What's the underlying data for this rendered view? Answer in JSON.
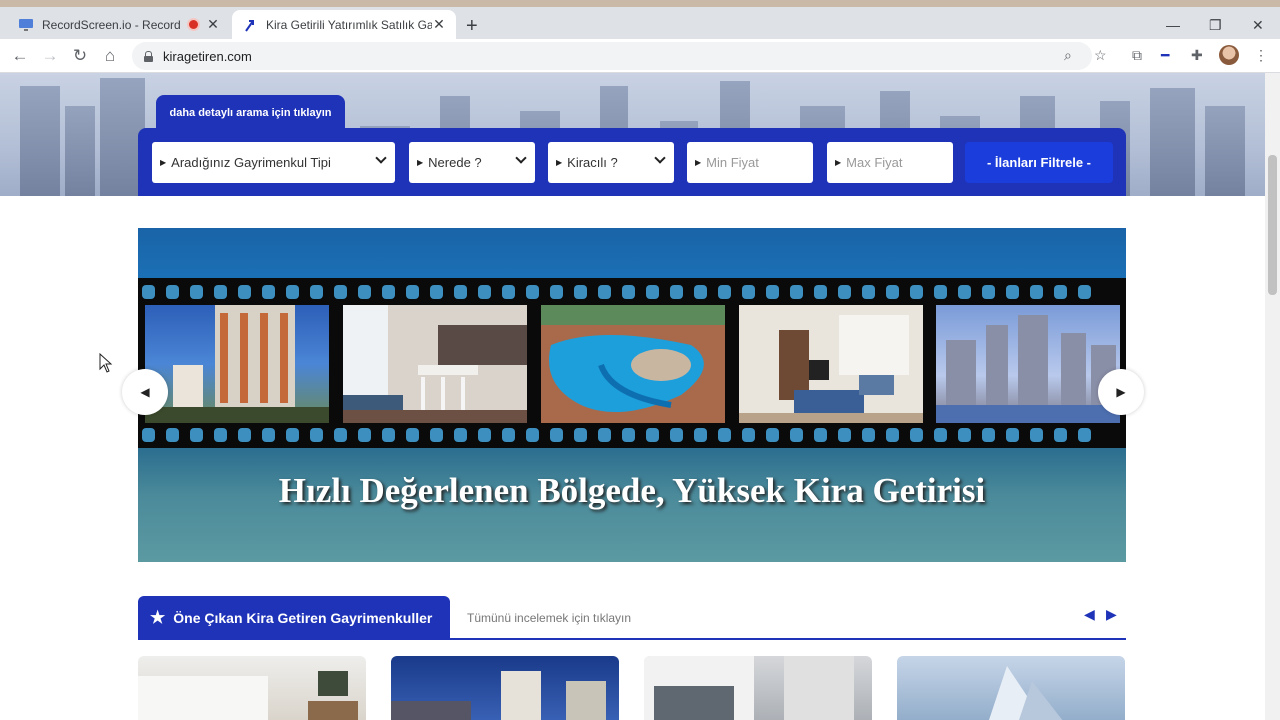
{
  "browser": {
    "tabs": [
      {
        "title": "RecordScreen.io - Record yo",
        "active": false,
        "recording": true
      },
      {
        "title": "Kira Getirili Yatırımlık Satılık Gayr",
        "active": true,
        "recording": false
      }
    ],
    "url": "kiragetiren.com"
  },
  "search": {
    "detail_tab": "daha detaylı arama için tıklayın",
    "property_type": "Aradığınız Gayrimenkul Tipi",
    "location": "Nerede ?",
    "tenant": "Kiracılı ?",
    "min_price_placeholder": "Min Fiyat",
    "max_price_placeholder": "Max Fiyat",
    "filter_button": "- İlanları Filtrele -"
  },
  "banner": {
    "headline": "Hızlı Değerlenen Bölgede, Yüksek Kira Getirisi"
  },
  "featured": {
    "title": "Öne Çıkan Kira Getiren Gayrimenkuller",
    "view_all": "Tümünü incelemek için tıklayın"
  },
  "icons": {
    "back": "arrow-left-icon",
    "forward": "arrow-right-icon",
    "reload": "reload-icon",
    "home": "home-icon",
    "zoom": "zoom-icon",
    "bookmark": "star-icon",
    "featured_star": "star-icon"
  },
  "colors": {
    "brand_blue": "#1f33b8",
    "button_blue": "#1b3ddc"
  }
}
